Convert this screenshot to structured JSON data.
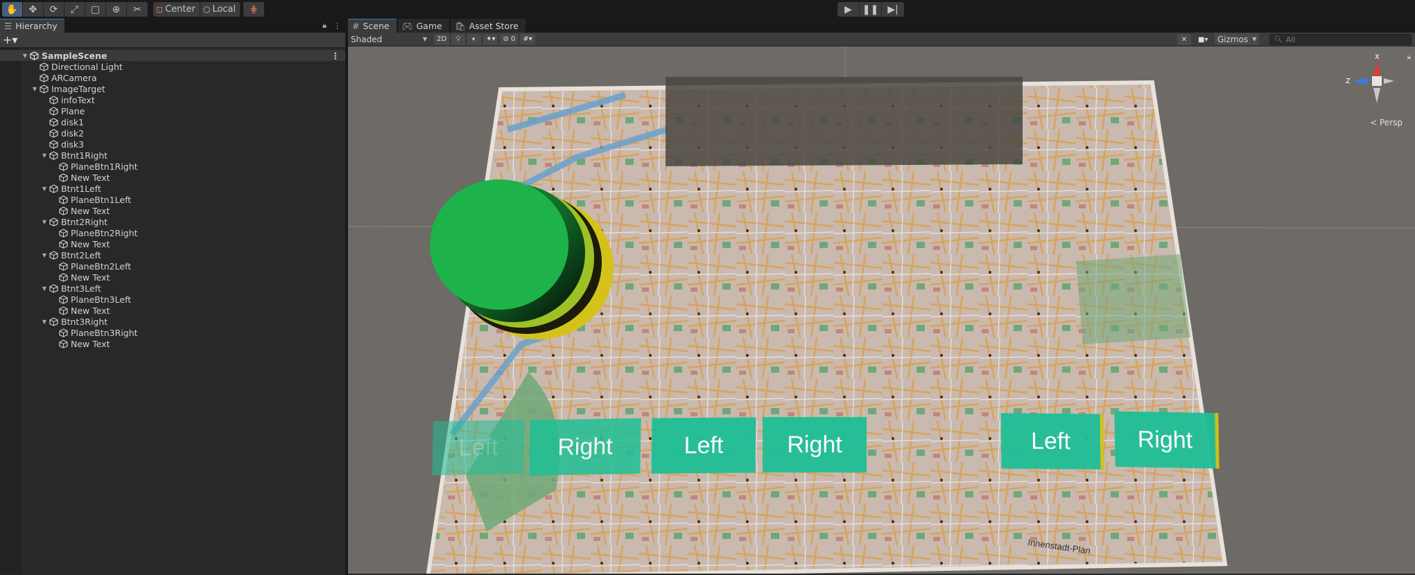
{
  "toolbar": {
    "tools": [
      "hand-tool",
      "move-tool",
      "rotate-tool",
      "scale-tool",
      "rect-tool",
      "transform-tool",
      "custom-tool"
    ],
    "pivot_label": "Center",
    "space_label": "Local"
  },
  "hierarchy": {
    "tab_label": "Hierarchy",
    "search_placeholder": "All",
    "scene_name": "SampleScene",
    "items": [
      {
        "label": "Directional Light",
        "depth": 1,
        "expandable": false
      },
      {
        "label": "ARCamera",
        "depth": 1,
        "expandable": false
      },
      {
        "label": "ImageTarget",
        "depth": 1,
        "expandable": true
      },
      {
        "label": "infoText",
        "depth": 2,
        "expandable": false
      },
      {
        "label": "Plane",
        "depth": 2,
        "expandable": false
      },
      {
        "label": "disk1",
        "depth": 2,
        "expandable": false
      },
      {
        "label": "disk2",
        "depth": 2,
        "expandable": false
      },
      {
        "label": "disk3",
        "depth": 2,
        "expandable": false
      },
      {
        "label": "Btnt1Right",
        "depth": 2,
        "expandable": true
      },
      {
        "label": "PlaneBtn1Right",
        "depth": 3,
        "expandable": false
      },
      {
        "label": "New Text",
        "depth": 3,
        "expandable": false
      },
      {
        "label": "Btnt1Left",
        "depth": 2,
        "expandable": true
      },
      {
        "label": "PlaneBtn1Left",
        "depth": 3,
        "expandable": false
      },
      {
        "label": "New Text",
        "depth": 3,
        "expandable": false
      },
      {
        "label": "Btnt2Right",
        "depth": 2,
        "expandable": true
      },
      {
        "label": "PlaneBtn2Right",
        "depth": 3,
        "expandable": false
      },
      {
        "label": "New Text",
        "depth": 3,
        "expandable": false
      },
      {
        "label": "Btnt2Left",
        "depth": 2,
        "expandable": true
      },
      {
        "label": "PlaneBtn2Left",
        "depth": 3,
        "expandable": false
      },
      {
        "label": "New Text",
        "depth": 3,
        "expandable": false
      },
      {
        "label": "Btnt3Left",
        "depth": 2,
        "expandable": true
      },
      {
        "label": "PlaneBtn3Left",
        "depth": 3,
        "expandable": false
      },
      {
        "label": "New Text",
        "depth": 3,
        "expandable": false
      },
      {
        "label": "Btnt3Right",
        "depth": 2,
        "expandable": true
      },
      {
        "label": "PlaneBtn3Right",
        "depth": 3,
        "expandable": false
      },
      {
        "label": "New Text",
        "depth": 3,
        "expandable": false
      }
    ]
  },
  "scene": {
    "tabs": [
      {
        "label": "Scene",
        "icon": "scene-icon"
      },
      {
        "label": "Game",
        "icon": "gamepad-icon"
      },
      {
        "label": "Asset Store",
        "icon": "store-icon"
      }
    ],
    "shading_mode": "Shaded",
    "mode_2d": "2D",
    "hidden_count": "0",
    "gizmos_label": "Gizmos",
    "search_placeholder": "All",
    "projection_label": "Persp",
    "axis_x": "X",
    "axis_z": "Z",
    "buttons": [
      "Left",
      "Right",
      "Left",
      "Right",
      "Left",
      "Right"
    ],
    "map_caption": "Innenstadt-Plan"
  },
  "colors": {
    "accent": "#3a79bb",
    "disk_green": "#1db34a",
    "disk_yellow": "#d4c21a",
    "button_teal": "#1fbf96"
  }
}
